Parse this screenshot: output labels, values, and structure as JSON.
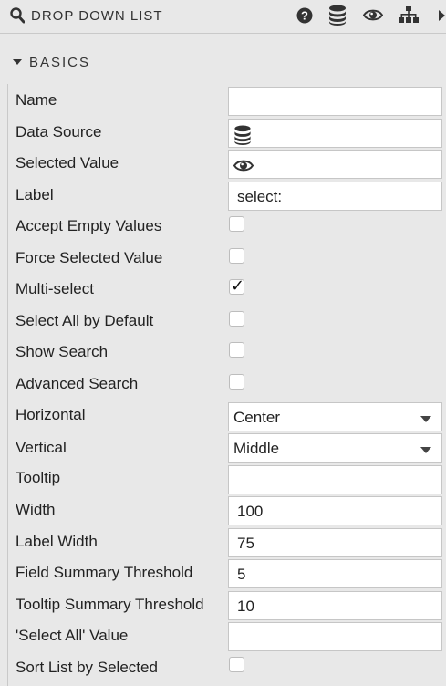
{
  "header": {
    "title": "DROP DOWN LIST",
    "icons": [
      "search-icon",
      "help-icon",
      "database-icon",
      "eye-icon",
      "hierarchy-icon",
      "expand-arrow-icon"
    ]
  },
  "section": {
    "label": "BASICS",
    "expanded": true
  },
  "properties": {
    "name": {
      "label": "Name",
      "value": ""
    },
    "data_source": {
      "label": "Data Source",
      "icon": "database-icon"
    },
    "selected_value": {
      "label": "Selected Value",
      "icon": "eye-icon"
    },
    "label": {
      "label": "Label",
      "value": "select:"
    },
    "accept_empty": {
      "label": "Accept Empty Values",
      "checked": false
    },
    "force_selected": {
      "label": "Force Selected Value",
      "checked": false
    },
    "multi_select": {
      "label": "Multi-select",
      "checked": true,
      "tick": "✓"
    },
    "select_all_default": {
      "label": "Select All by Default",
      "checked": false
    },
    "show_search": {
      "label": "Show Search",
      "checked": false
    },
    "advanced_search": {
      "label": "Advanced Search",
      "checked": false
    },
    "horizontal": {
      "label": "Horizontal",
      "value": "Center"
    },
    "vertical": {
      "label": "Vertical",
      "value": "Middle"
    },
    "tooltip": {
      "label": "Tooltip",
      "value": ""
    },
    "width": {
      "label": "Width",
      "value": "100"
    },
    "label_width": {
      "label": "Label Width",
      "value": "75"
    },
    "field_summary": {
      "label": "Field Summary Threshold",
      "value": "5"
    },
    "tooltip_summary": {
      "label": "Tooltip Summary Threshold",
      "value": "10"
    },
    "select_all_value": {
      "label": "'Select All' Value",
      "value": ""
    },
    "sort_by_selected": {
      "label": "Sort List by Selected",
      "checked": false
    }
  }
}
